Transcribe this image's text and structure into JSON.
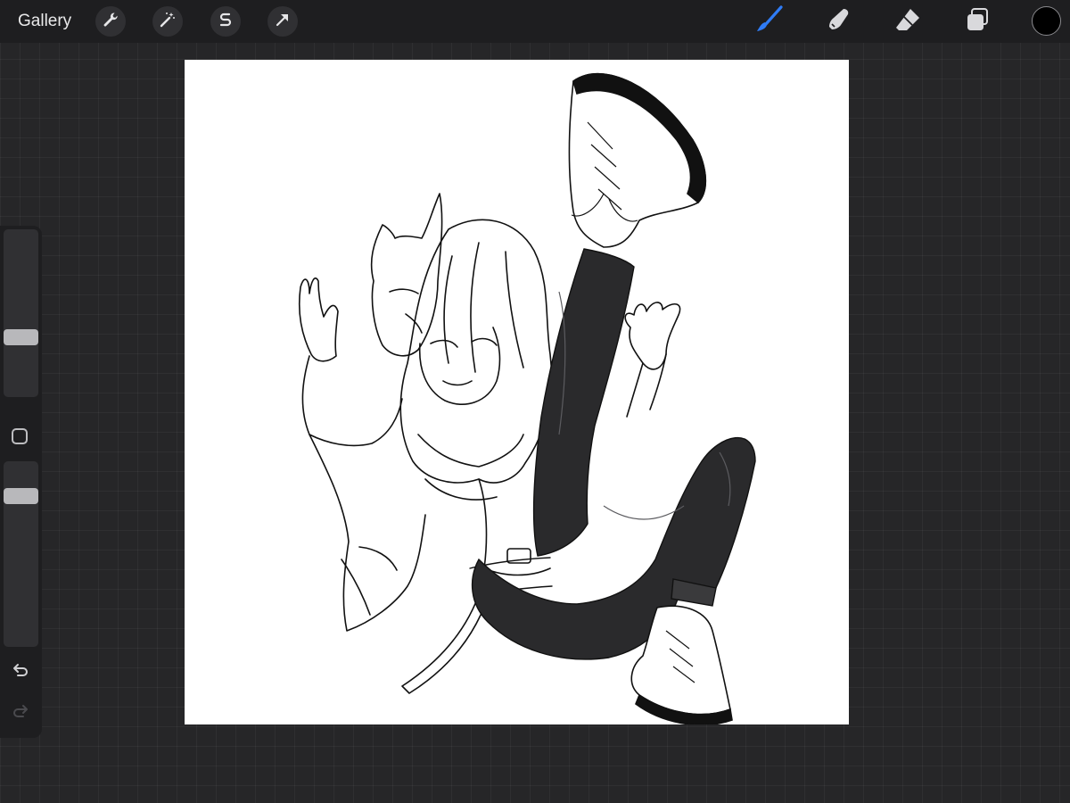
{
  "toolbar": {
    "gallery_label": "Gallery",
    "left_tools": [
      {
        "name": "actions",
        "icon": "wrench-icon"
      },
      {
        "name": "adjustments",
        "icon": "magic-wand-icon"
      },
      {
        "name": "selection",
        "icon": "selection-s-icon"
      },
      {
        "name": "transform",
        "icon": "arrow-cursor-icon"
      }
    ],
    "right_tools": [
      {
        "name": "brush",
        "icon": "brush-icon",
        "active": true
      },
      {
        "name": "smudge",
        "icon": "smudge-finger-icon",
        "active": false
      },
      {
        "name": "eraser",
        "icon": "eraser-icon",
        "active": false
      },
      {
        "name": "layers",
        "icon": "layers-icon",
        "active": false
      }
    ],
    "current_color": "#000000",
    "active_color": "#2f7cf6"
  },
  "sidebar": {
    "brush_size_level": 0.34,
    "opacity_level": 0.84,
    "modify_icon": "square-icon",
    "undo_icon": "undo-arrow-icon",
    "redo_icon": "redo-arrow-icon",
    "redo_enabled": false
  },
  "canvas": {
    "background": "#ffffff",
    "artwork": "anime-character-lineart-illustration"
  }
}
